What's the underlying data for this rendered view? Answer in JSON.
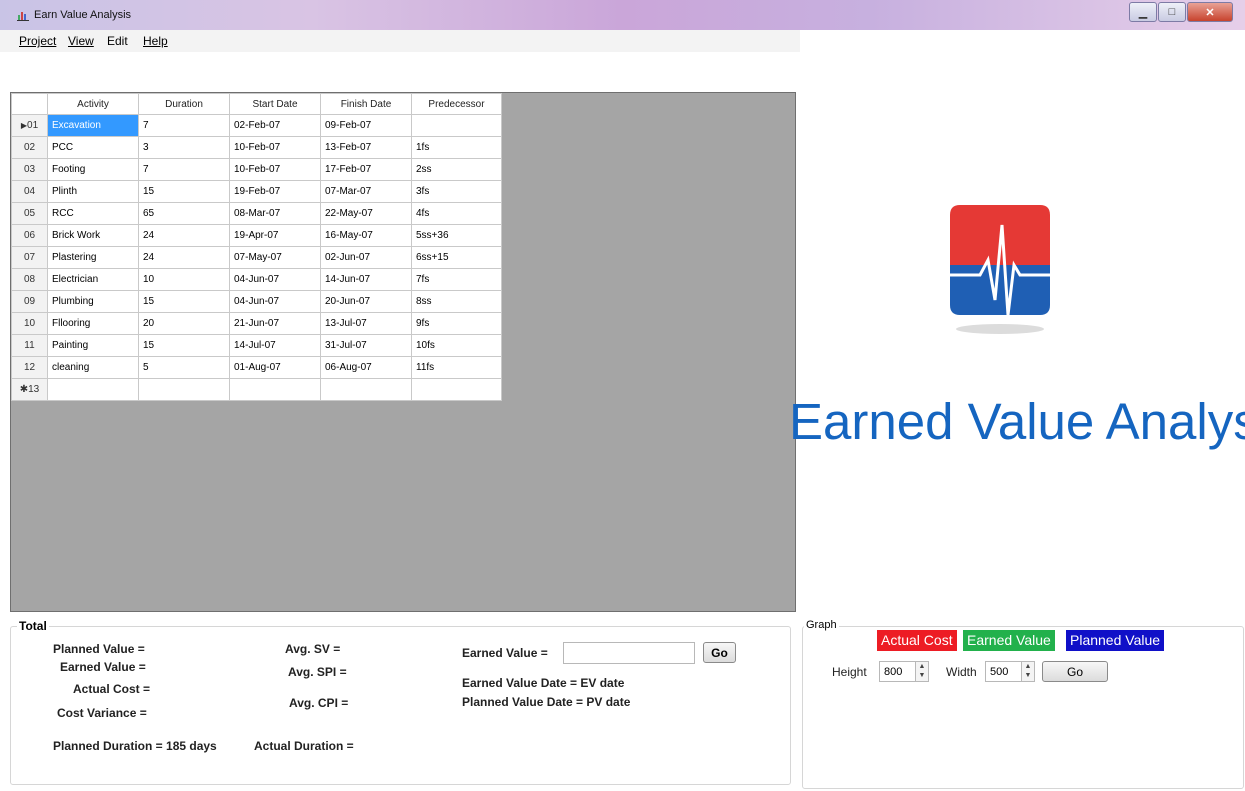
{
  "window": {
    "title": "Earn Value Analysis",
    "minimize_icon": "minimize-icon",
    "maximize_icon": "maximize-icon",
    "close_icon": "close-icon"
  },
  "menu": [
    "Project",
    "View",
    "Edit",
    "Help"
  ],
  "grid": {
    "columns": [
      "Activity",
      "Duration",
      "Start Date",
      "Finish Date",
      "Predecessor"
    ],
    "rows": [
      {
        "id": "01",
        "activity": "Excavation",
        "duration": "7",
        "start": "02-Feb-07",
        "finish": "09-Feb-07",
        "pred": ""
      },
      {
        "id": "02",
        "activity": "PCC",
        "duration": "3",
        "start": "10-Feb-07",
        "finish": "13-Feb-07",
        "pred": "1fs"
      },
      {
        "id": "03",
        "activity": "Footing",
        "duration": "7",
        "start": "10-Feb-07",
        "finish": "17-Feb-07",
        "pred": "2ss"
      },
      {
        "id": "04",
        "activity": "Plinth",
        "duration": "15",
        "start": "19-Feb-07",
        "finish": "07-Mar-07",
        "pred": "3fs"
      },
      {
        "id": "05",
        "activity": "RCC",
        "duration": "65",
        "start": "08-Mar-07",
        "finish": "22-May-07",
        "pred": "4fs"
      },
      {
        "id": "06",
        "activity": "Brick Work",
        "duration": "24",
        "start": "19-Apr-07",
        "finish": "16-May-07",
        "pred": "5ss+36"
      },
      {
        "id": "07",
        "activity": "Plastering",
        "duration": "24",
        "start": "07-May-07",
        "finish": "02-Jun-07",
        "pred": "6ss+15"
      },
      {
        "id": "08",
        "activity": "Electrician",
        "duration": "10",
        "start": "04-Jun-07",
        "finish": "14-Jun-07",
        "pred": "7fs"
      },
      {
        "id": "09",
        "activity": "Plumbing",
        "duration": "15",
        "start": "04-Jun-07",
        "finish": "20-Jun-07",
        "pred": "8ss"
      },
      {
        "id": "10",
        "activity": "Fllooring",
        "duration": "20",
        "start": "21-Jun-07",
        "finish": "13-Jul-07",
        "pred": "9fs"
      },
      {
        "id": "11",
        "activity": "Painting",
        "duration": "15",
        "start": "14-Jul-07",
        "finish": "31-Jul-07",
        "pred": "10fs"
      },
      {
        "id": "12",
        "activity": " cleaning",
        "duration": "5",
        "start": "01-Aug-07",
        "finish": "06-Aug-07",
        "pred": "11fs"
      }
    ],
    "current_row_marker": "▶",
    "new_row_id": "13",
    "new_row_marker": "✱"
  },
  "logo": {
    "text": "Earned Value Analysis",
    "colors": {
      "red": "#e53935",
      "blue": "#1f5fb4"
    }
  },
  "total": {
    "group_title": "Total",
    "planned_value_label": "Planned Value =",
    "earned_value_label": "Earned Value =",
    "actual_cost_label": "Actual Cost =",
    "cost_variance_label": "Cost Variance =",
    "planned_duration_label": "Planned Duration  = 185  days",
    "actual_duration_label": "Actual Duration  =",
    "avg_sv_label": "Avg. SV =",
    "avg_spi_label": "Avg. SPI =",
    "avg_cpi_label": "Avg. CPI =",
    "ev_input_label": "Earned Value =",
    "ev_input_value": "",
    "go_label": "Go",
    "ev_date_label": "Earned Value Date =   EV date",
    "pv_date_label": "Planned Value Date =  PV date"
  },
  "graph": {
    "group_title": "Graph",
    "legend": [
      {
        "label": "Actual Cost",
        "color": "#ed1c24"
      },
      {
        "label": "Earned Value",
        "color": "#22b14c"
      },
      {
        "label": "Planned Value",
        "color": "#1010c8"
      }
    ],
    "height_label": "Height",
    "height_value": "800",
    "width_label": "Width",
    "width_value": "500",
    "go_label": "Go"
  }
}
